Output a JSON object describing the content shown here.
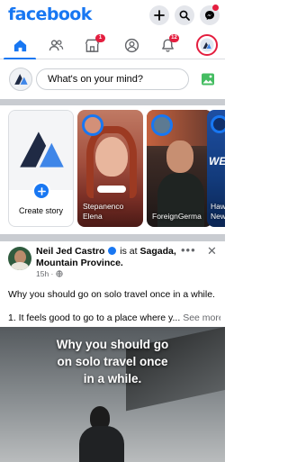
{
  "header": {
    "logo": "facebook",
    "brand_color": "#1877f2",
    "actions": [
      {
        "name": "create",
        "icon": "plus-icon"
      },
      {
        "name": "search",
        "icon": "search-icon"
      },
      {
        "name": "messenger",
        "icon": "messenger-icon",
        "badge": ""
      }
    ]
  },
  "tabs": {
    "items": [
      {
        "name": "home",
        "icon": "home-icon",
        "active": true
      },
      {
        "name": "friends",
        "icon": "friends-icon",
        "active": false
      },
      {
        "name": "marketplace",
        "icon": "marketplace-icon",
        "badge": "1"
      },
      {
        "name": "profile",
        "icon": "profile-icon",
        "active": false
      },
      {
        "name": "notifications",
        "icon": "bell-icon",
        "badge": "12"
      },
      {
        "name": "menu",
        "icon": "menu-avatar-icon",
        "active": false
      }
    ]
  },
  "composer": {
    "placeholder": "What's on your mind?",
    "photo_icon": "photo-icon"
  },
  "stories": [
    {
      "type": "create",
      "label": "Create story"
    },
    {
      "name": "Stepanenco Elena"
    },
    {
      "name": "ForeignGerma"
    },
    {
      "name": "Haw New"
    }
  ],
  "post": {
    "author": "Neil Jed Castro",
    "verb": "is at",
    "location": "Sagada, Mountain Province.",
    "time": "15h",
    "audience_icon": "globe-icon",
    "line1": "Why you should go on solo travel once in a while.",
    "line2": "1. It feels good to go to a place where y...",
    "see_more": "See more",
    "media_caption_1": "Why you should go",
    "media_caption_2": "on solo travel once",
    "media_caption_3": "in a while."
  }
}
